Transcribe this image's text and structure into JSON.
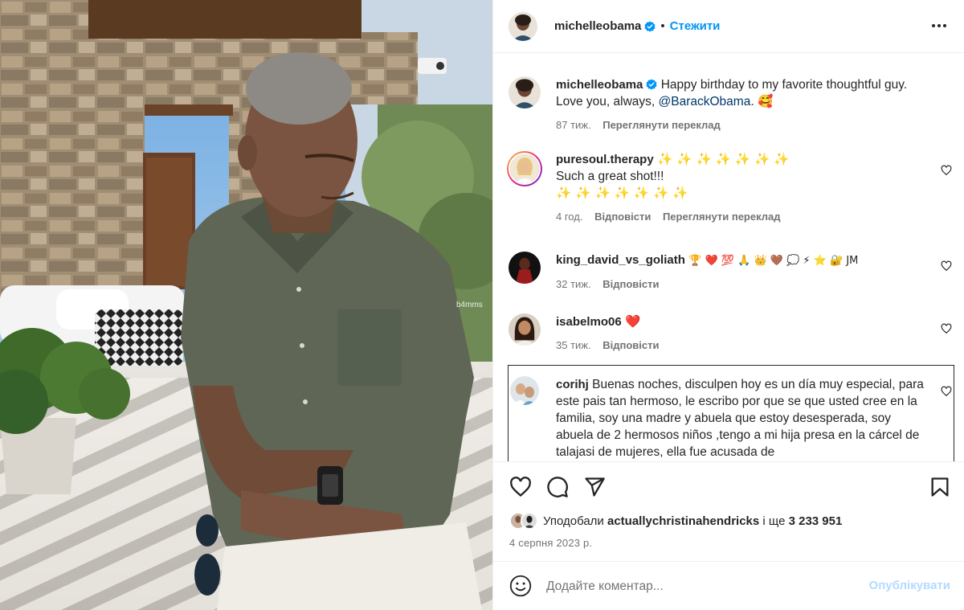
{
  "photo": {
    "watermark": "b4mms"
  },
  "header": {
    "username": "michelleobama",
    "follow_label": "Стежити",
    "separator": "•"
  },
  "caption": {
    "username": "michelleobama",
    "text_before": "Happy birthday to my favorite thoughtful guy. Love you, always, ",
    "mention": "@BarackObama",
    "text_after": ". ",
    "emoji": "🥰",
    "time": "87 тиж.",
    "translate_label": "Переглянути переклад"
  },
  "comments": [
    {
      "username": "puresoul.therapy",
      "text": "✨ ✨ ✨ ✨ ✨ ✨ ✨",
      "text2": "Such a great shot!!!",
      "text3": "✨ ✨ ✨ ✨ ✨ ✨ ✨",
      "time": "4 год.",
      "reply_label": "Відповісти",
      "translate_label": "Переглянути переклад"
    },
    {
      "username": "king_david_vs_goliath",
      "text": "🏆 ❤️ 💯 🙏 👑 🤎 💭 ⚡ ⭐ 🔐 JM",
      "time": "32 тиж.",
      "reply_label": "Відповісти"
    },
    {
      "username": "isabelmo06",
      "text": "❤️",
      "time": "35 тиж.",
      "reply_label": "Відповісти"
    },
    {
      "username": "corihj",
      "text": "Buenas noches, disculpen hoy es un día muy especial, para este pais tan hermoso, le escribo por que se que usted cree en la familia, soy una madre y abuela que estoy desesperada, soy abuela de 2 hermosos niños ,tengo a mi hija presa en la cárcel de talajasi de mujeres, ella fue acusada de"
    }
  ],
  "likes": {
    "prefix": "Уподобали",
    "user": "actuallychristinahendricks",
    "conj": "і ще",
    "count": "3 233 951"
  },
  "date": "4 серпня 2023 р.",
  "add_comment": {
    "placeholder": "Додайте коментар...",
    "post_label": "Опублікувати"
  },
  "colors": {
    "accent": "#0095f6",
    "post_disabled": "#b3dbff",
    "text": "#262626",
    "secondary": "#737373",
    "like_red": "#ed4956"
  }
}
